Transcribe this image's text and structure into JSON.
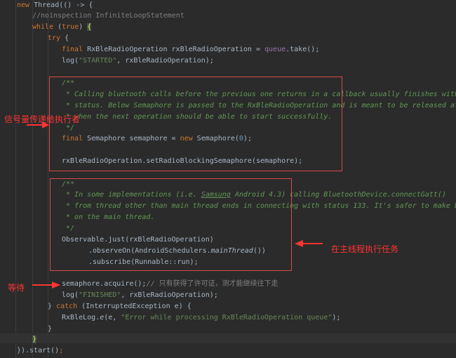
{
  "code": {
    "l1": {
      "a": "new ",
      "b": "Thread(() -> {"
    },
    "l2": "//noinspection InfiniteLoopStatement",
    "l3": {
      "a": "while ",
      "b": "(",
      "c": "true",
      "d": ") ",
      "e": "{"
    },
    "l4": {
      "a": "try ",
      "b": "{"
    },
    "l5": {
      "a": "final ",
      "b": "RxBleRadioOperation rxBleRadioOperation = ",
      "c": "queue",
      "d": ".take();"
    },
    "l6": {
      "a": "log(",
      "b": "\"STARTED\"",
      "c": ", rxBleRadioOperation);"
    },
    "l7": "/**",
    "l8": " * Calling bluetooth calls before the previous one returns in a callback usually finishes with a failure",
    "l9": " * status. Below Semaphore is passed to the RxBleRadioOperation and is meant to be released at appropriate time",
    "l10": " * when the next operation should be able to start successfully.",
    "l11": " */",
    "l12": {
      "a": "final ",
      "b": "Semaphore semaphore = ",
      "c": "new ",
      "d": "Semaphore(",
      "e": "0",
      "f": ");"
    },
    "l13": "rxBleRadioOperation.setRadioBlockingSemaphore(semaphore);",
    "l14": "/**",
    "l15": {
      "a": " * In some implementations (i.e. ",
      "b": "Samsung",
      "c": " Android 4.3) calling BluetoothDevice.connectGatt()"
    },
    "l16": " * from thread other than main thread ends in connecting with status 133. It's safer to make bluetooth calls",
    "l17": " * on the main thread.",
    "l18": " */",
    "l19": "Observable.just(rxBleRadioOperation)",
    "l20": {
      "a": ".observeOn(AndroidSchedulers.",
      "b": "mainThread",
      "c": "())"
    },
    "l21": ".subscribe(Runnable::run);",
    "l22": {
      "a": "semaphore.acquire();",
      "b": "// 只有获得了许可证，测才能继续往下走"
    },
    "l23": {
      "a": "log(",
      "b": "\"FINISHED\"",
      "c": ", rxBleRadioOperation);"
    },
    "l24": {
      "a": "} ",
      "b": "catch ",
      "c": "(InterruptedException e) {"
    },
    "l25": {
      "a": "RxBleLog.",
      "b": "e",
      "c": "(e, ",
      "d": "\"Error while processing RxBleRadioOperation queue\"",
      "e": ");"
    },
    "l26": "}",
    "l27": "}",
    "l28": {
      "a": "}).start()",
      "b": ";"
    }
  },
  "annotations": {
    "semaphore_note": "信号量传递给执行者",
    "main_thread_note": "在主线程执行任务",
    "wait_note": "等待"
  },
  "colors": {
    "background": "#2b2b2b",
    "keyword": "#cc7832",
    "string": "#6a8759",
    "doc_comment": "#629755",
    "annotation_red": "#ff3333",
    "box_border": "#d84a4a"
  }
}
